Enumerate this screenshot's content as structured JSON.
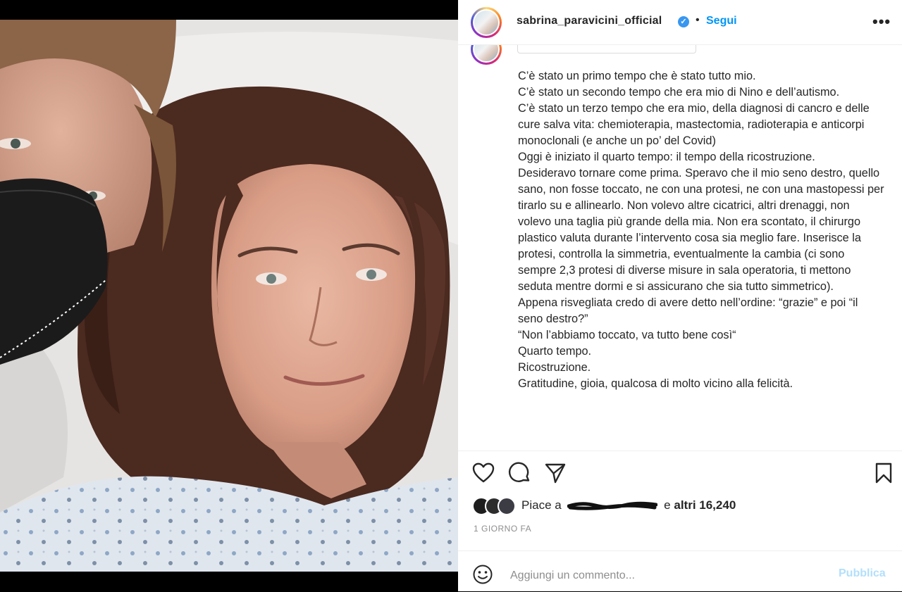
{
  "post": {
    "username": "sabrina_paravicini_official",
    "separator": "•",
    "follow_label": "Segui",
    "more_label": "•••"
  },
  "caption": {
    "text": "C’è stato un primo tempo che è stato tutto mio.\nC’è stato un secondo tempo che era mio di Nino e dell’autismo.\nC’è stato un terzo tempo che era mio, della diagnosi di cancro e delle cure salva vita: chemioterapia, mastectomia, radioterapia e anticorpi monoclonali (e anche un po’ del Covid)\nOggi è iniziato il quarto tempo: il tempo della ricostruzione.\nDesideravo tornare come prima. Speravo che il mio seno destro, quello sano, non fosse toccato, ne con una protesi, ne con una mastopessi per tirarlo su e allinearlo. Non volevo altre cicatrici, altri drenaggi, non volevo una taglia più grande della mia. Non era scontato, il chirurgo plastico valuta durante l’intervento cosa sia meglio fare. Inserisce la protesi, controlla la simmetria, eventualmente la cambia (ci sono sempre 2,3 protesi di diverse misure in sala operatoria, ti mettono seduta mentre dormi e si assicurano che sia tutto simmetrico).\nAppena risvegliata credo di avere detto nell’ordine: “grazie” e poi “il seno destro?”\n“Non l’abbiamo toccato, va tutto bene così“\nQuarto tempo.\nRicostruzione.\nGratitudine, gioia, qualcosa di molto vicino alla felicità."
  },
  "likes": {
    "prefix": "Piace a",
    "middle": "e",
    "count_label": "altri 16,240"
  },
  "time": "1 GIORNO FA",
  "comment": {
    "placeholder": "Aggiungi un commento...",
    "publish_label": "Pubblica"
  },
  "icons": [
    "heart-icon",
    "comment-icon",
    "share-icon",
    "bookmark-icon",
    "emoji-icon",
    "verified-icon",
    "more-icon"
  ],
  "colors": {
    "link": "#0095f6",
    "verified": "#3897f0",
    "publish_disabled": "#b2dffc",
    "muted": "#8e8e8e",
    "text": "#262626"
  }
}
